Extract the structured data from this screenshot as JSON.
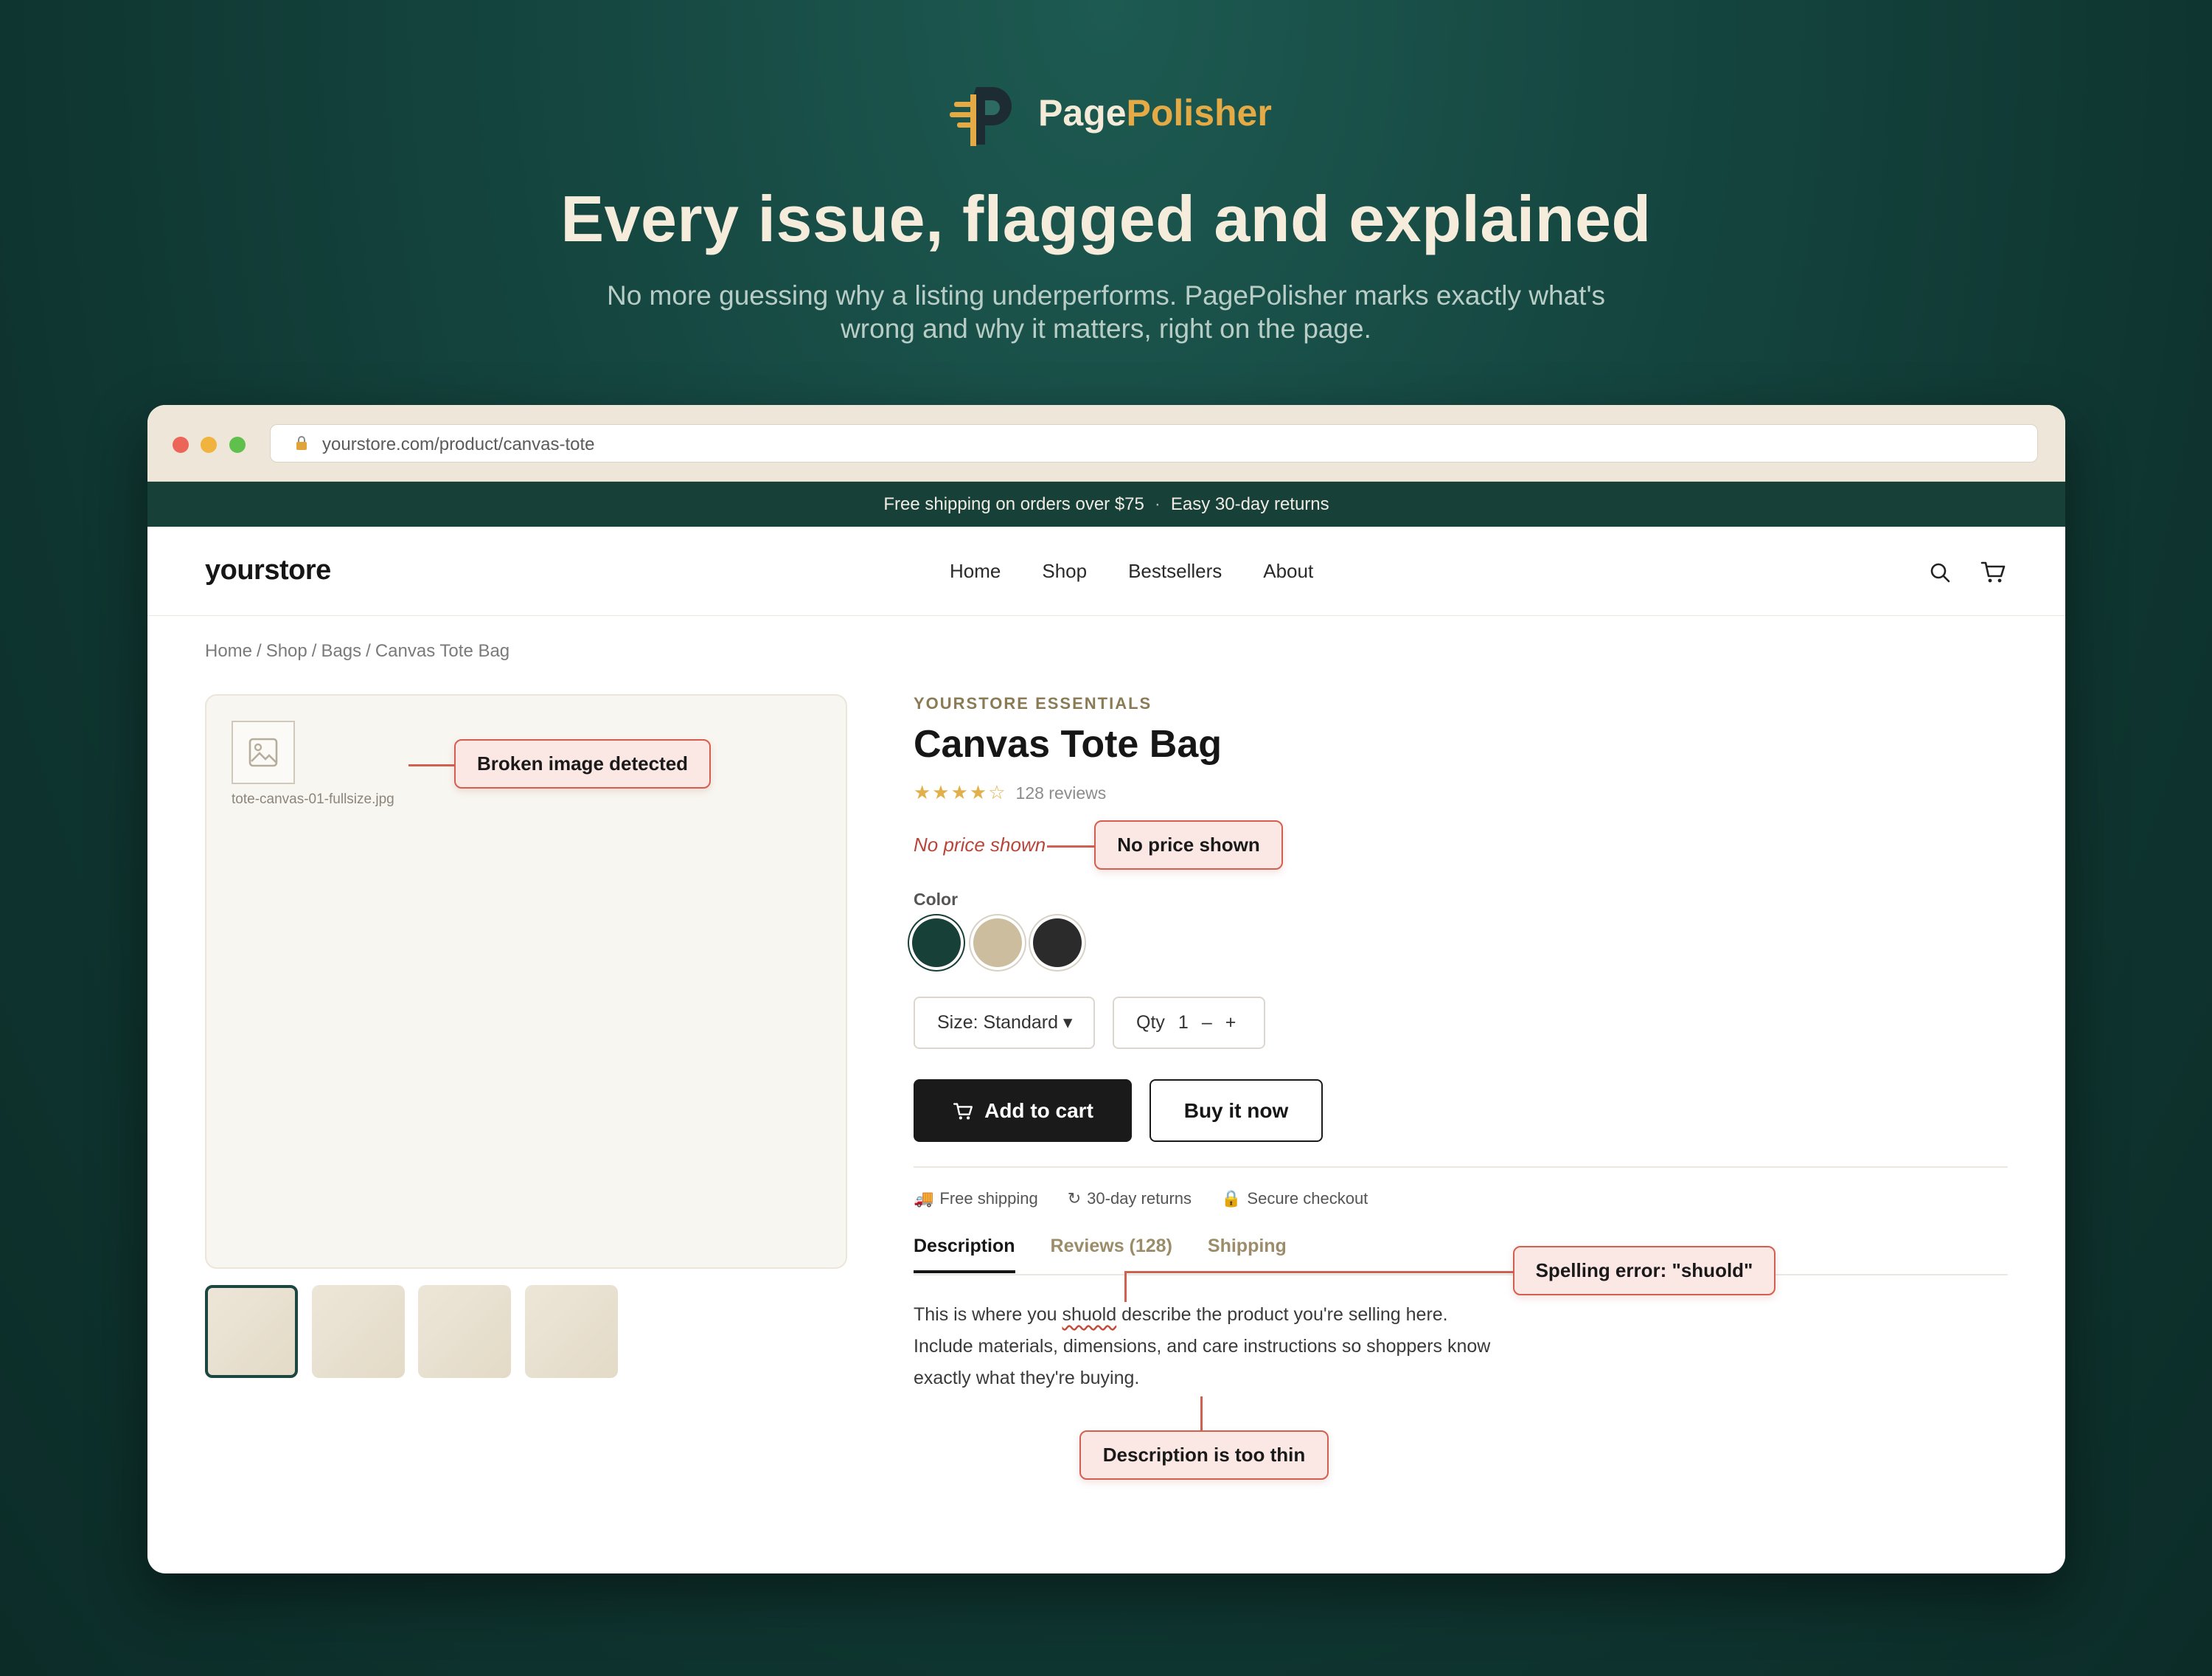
{
  "hero": {
    "brand_part1": "Page",
    "brand_part2": "Polisher",
    "headline": "Every issue, flagged and explained",
    "subhead": "No more guessing why a listing underperforms. PagePolisher marks exactly what's wrong and why it matters, right on the page.",
    "logo_icon": "pagepolisher-logo"
  },
  "browser": {
    "url": "yourstore.com/product/canvas-tote",
    "lock_icon": "lock-icon"
  },
  "store": {
    "announcement": {
      "left": "Free shipping on orders over $75",
      "separator": "·",
      "right": "Easy 30-day returns"
    },
    "logo": "yourstore",
    "nav": [
      "Home",
      "Shop",
      "Bestsellers",
      "About"
    ],
    "breadcrumb": [
      "Home",
      "Shop",
      "Bags",
      "Canvas Tote Bag"
    ],
    "breadcrumb_sep": "/",
    "gallery": {
      "broken_filename": "tote-canvas-01-fullsize.jpg"
    },
    "product": {
      "brand": "YOURSTORE ESSENTIALS",
      "title": "Canvas Tote Bag",
      "stars": "★★★★☆",
      "rating": 4,
      "review_count": "128 reviews",
      "price_missing": "No price shown",
      "color_label": "Color",
      "colors": [
        "#174039",
        "#cbbd9e",
        "#2b2b2b"
      ],
      "size_label": "Size: Standard ▾",
      "qty_label": "Qty",
      "qty_value": "1",
      "qty_minus": "–",
      "qty_plus": "+",
      "add_to_cart": "Add to cart",
      "buy_now": "Buy it now",
      "perks": [
        {
          "icon": "🚚",
          "label": "Free shipping"
        },
        {
          "icon": "↻",
          "label": "30-day returns"
        },
        {
          "icon": "🔒",
          "label": "Secure checkout"
        }
      ],
      "tabs": [
        "Description",
        "Reviews (128)",
        "Shipping"
      ],
      "description": {
        "before": "This is where you ",
        "misspelled": "shuold",
        "after": " describe the product you're selling here. Include materials, dimensions, and care instructions so shoppers know exactly what they're buying."
      }
    }
  },
  "callouts": {
    "broken_image": "Broken image detected",
    "no_price": "No price shown",
    "spelling": "Spelling error: \"shuold\"",
    "thin_description": "Description is too thin"
  }
}
